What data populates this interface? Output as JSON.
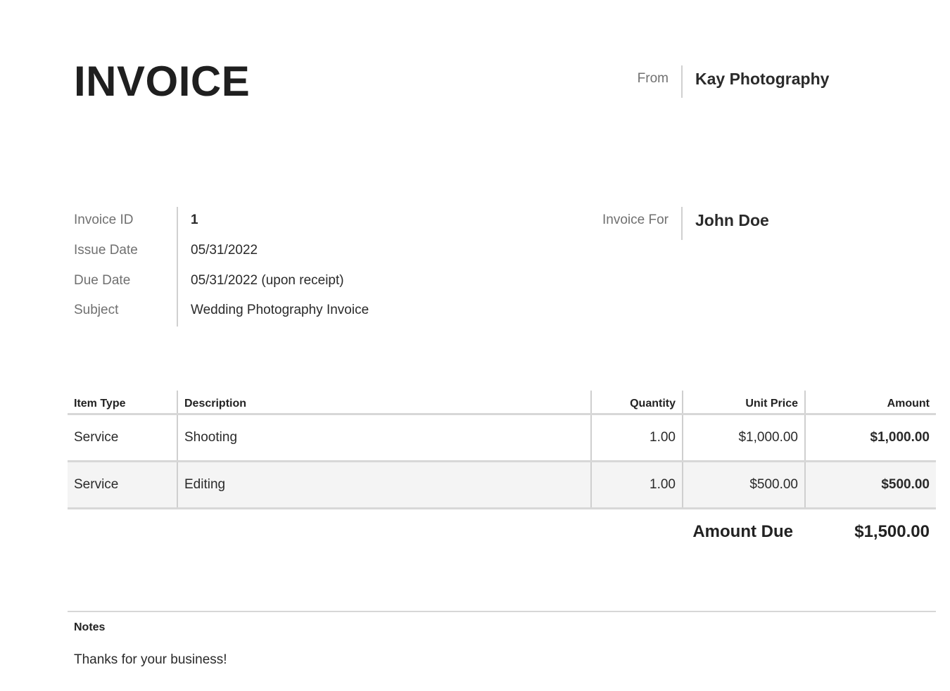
{
  "header": {
    "title": "INVOICE",
    "from_label": "From",
    "from_name": "Kay Photography"
  },
  "meta": {
    "fields": [
      {
        "label": "Invoice ID",
        "value": "1"
      },
      {
        "label": "Issue Date",
        "value": "05/31/2022"
      },
      {
        "label": "Due Date",
        "value": "05/31/2022 (upon receipt)"
      },
      {
        "label": "Subject",
        "value": "Wedding Photography Invoice"
      }
    ],
    "for_label": "Invoice For",
    "for_name": "John Doe"
  },
  "table": {
    "columns": [
      "Item Type",
      "Description",
      "Quantity",
      "Unit Price",
      "Amount"
    ],
    "rows": [
      {
        "type": "Service",
        "description": "Shooting",
        "quantity": "1.00",
        "unit_price": "$1,000.00",
        "amount": "$1,000.00"
      },
      {
        "type": "Service",
        "description": "Editing",
        "quantity": "1.00",
        "unit_price": "$500.00",
        "amount": "$500.00"
      }
    ]
  },
  "totals": {
    "label": "Amount Due",
    "value": "$1,500.00"
  },
  "notes": {
    "label": "Notes",
    "text": "Thanks for your business!"
  },
  "colors": {
    "text": "#222222",
    "muted": "#707070",
    "rule": "#d7d7d7",
    "row_alt": "#f4f4f4"
  }
}
